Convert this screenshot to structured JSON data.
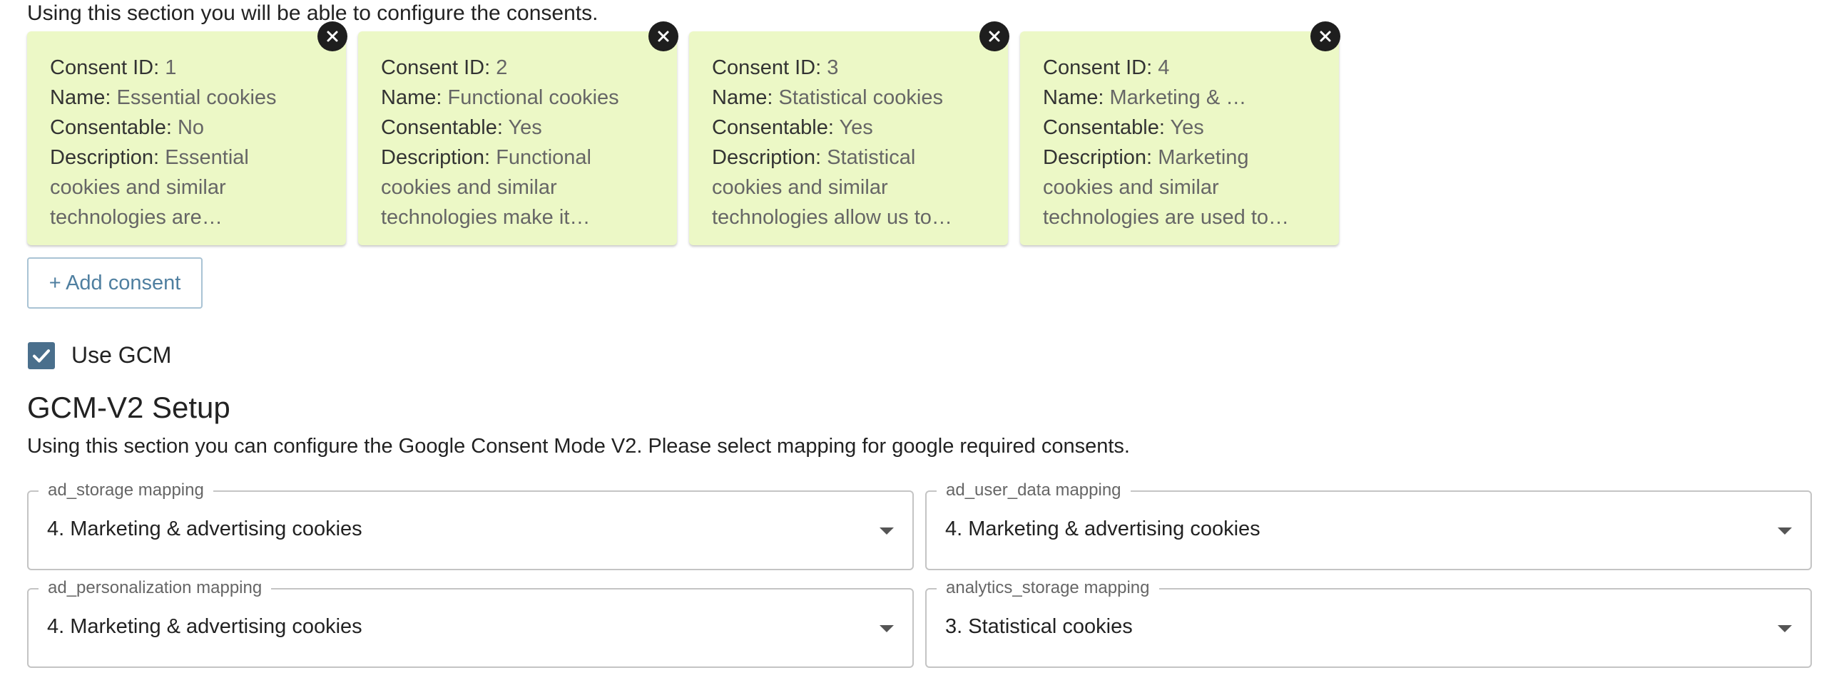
{
  "consent_section": {
    "intro": "Using this section you will be able to configure the consents.",
    "labels": {
      "id": "Consent ID:",
      "name": "Name:",
      "consentable": "Consentable:",
      "description": "Description:"
    },
    "cards": [
      {
        "id": "1",
        "name": "Essential cookies",
        "consentable": "No",
        "description": "Essential cookies and similar technologies are implementing the basic …"
      },
      {
        "id": "2",
        "name": "Functional cookies",
        "consentable": "Yes",
        "description": "Functional cookies and similar technologies make it possibl…"
      },
      {
        "id": "3",
        "name": "Statistical cookies",
        "consentable": "Yes",
        "description": "Statistical cookies and similar technologies allow us to collect information abo…"
      },
      {
        "id": "4",
        "name": "Marketing & …",
        "consentable": "Yes",
        "description": "Marketing cookies and similar technologies are used to trac…"
      }
    ],
    "add_button": "+ Add consent"
  },
  "gcm": {
    "checkbox_label": "Use GCM",
    "checked": true,
    "title": "GCM-V2 Setup",
    "description": "Using this section you can configure the Google Consent Mode V2. Please select mapping for google required consents.",
    "mappings": [
      {
        "label": "ad_storage mapping",
        "value": "4. Marketing & advertising cookies"
      },
      {
        "label": "ad_user_data mapping",
        "value": "4. Marketing & advertising cookies"
      },
      {
        "label": "ad_personalization mapping",
        "value": "4. Marketing & advertising cookies"
      },
      {
        "label": "analytics_storage mapping",
        "value": "3. Statistical cookies"
      }
    ]
  },
  "colors": {
    "card_bg": "#ecf8c6",
    "checkbox": "#4a6f8c",
    "button_text": "#4f7fa0"
  }
}
